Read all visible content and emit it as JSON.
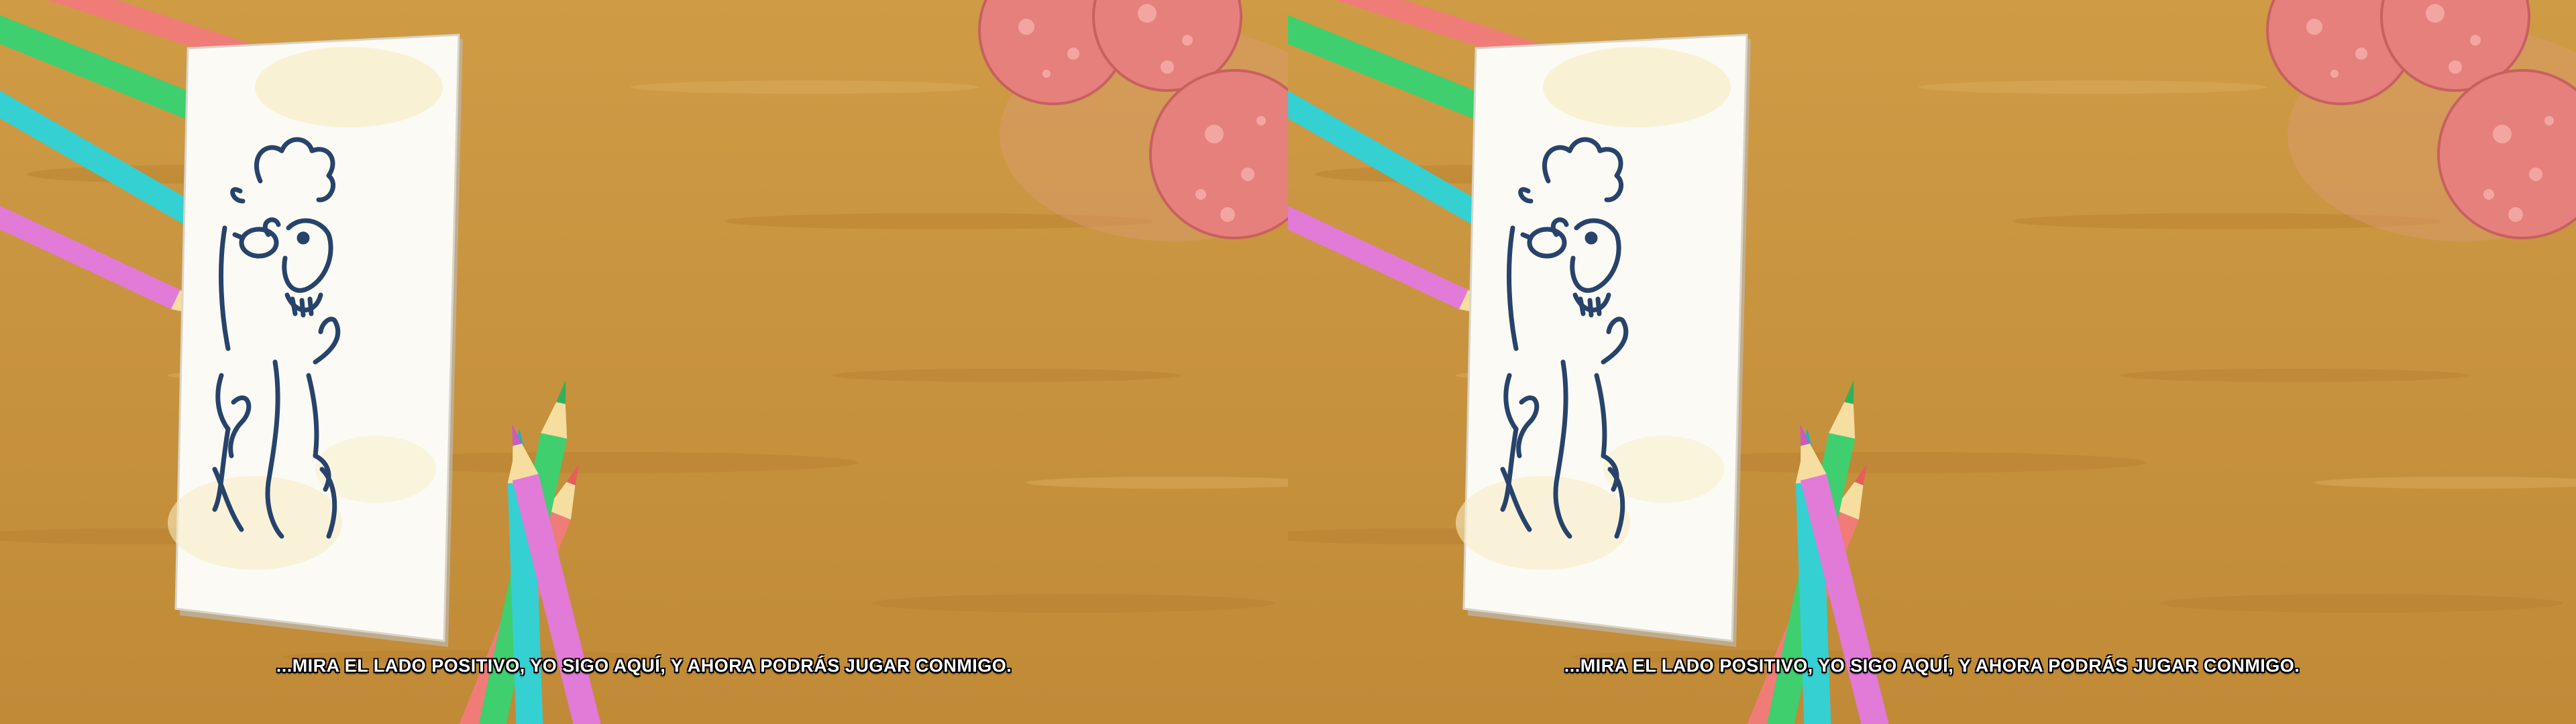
{
  "scene": {
    "subtitle": "...MIRA EL LADO POSITIVO, YO SIGO AQUÍ, Y AHORA PODRÁS JUGAR CONMIGO.",
    "layout": "side-by-side stereoscopic (two identical eyes)",
    "colors": {
      "table": "#c9943e",
      "paper": "#fbfaf4",
      "ink": "#27436b",
      "pencil_red": "#f07c78",
      "pencil_green": "#3fcf6e",
      "pencil_cyan": "#34d0d2",
      "pencil_magenta": "#e27ad8",
      "salami": "#e5807c"
    },
    "icons": [
      "paper-sheet",
      "drawing-of-creature",
      "colored-pencils",
      "salami-slices"
    ]
  }
}
